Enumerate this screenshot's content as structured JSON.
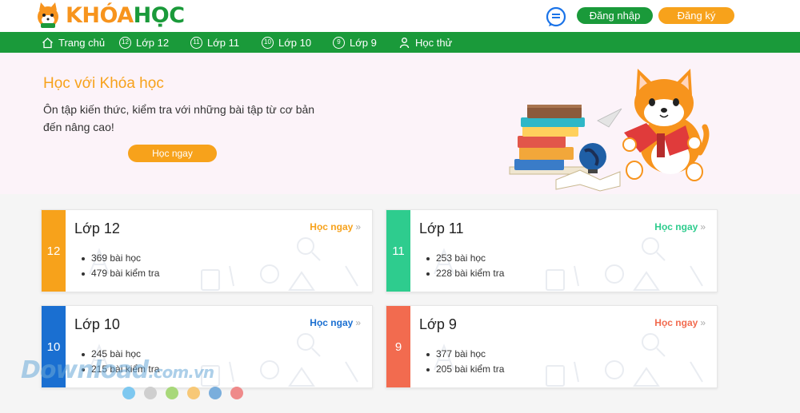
{
  "header": {
    "logo": {
      "part1": "KHÓA",
      "part2": "HỌC"
    },
    "login_label": "Đăng nhập",
    "register_label": "Đăng ký"
  },
  "nav": {
    "items": [
      {
        "label": "Trang chủ",
        "icon": "home-icon"
      },
      {
        "label": "Lớp 12",
        "icon": "12"
      },
      {
        "label": "Lớp 11",
        "icon": "11"
      },
      {
        "label": "Lớp 10",
        "icon": "10"
      },
      {
        "label": "Lớp 9",
        "icon": "9"
      },
      {
        "label": "Học thử",
        "icon": "user-icon"
      }
    ]
  },
  "hero": {
    "title": "Học với Khóa học",
    "description": "Ôn tập kiến thức, kiểm tra với những bài tập từ cơ bản đến nâng cao!",
    "button_label": "Học ngay"
  },
  "cards": [
    {
      "grade": "12",
      "title": "Lớp 12",
      "link": "Học ngay",
      "arrow": "»",
      "lessons": "369 bài học",
      "tests": "479 bài kiểm tra",
      "color": "#f7a21b"
    },
    {
      "grade": "11",
      "title": "Lớp 11",
      "link": "Học ngay",
      "arrow": "»",
      "lessons": "253 bài học",
      "tests": "228 bài kiểm tra",
      "color": "#2ecc8e"
    },
    {
      "grade": "10",
      "title": "Lớp 10",
      "link": "Học ngay",
      "arrow": "»",
      "lessons": "245 bài học",
      "tests": "215 bài kiểm tra",
      "color": "#1a6fd1"
    },
    {
      "grade": "9",
      "title": "Lớp 9",
      "link": "Học ngay",
      "arrow": "»",
      "lessons": "377 bài học",
      "tests": "205 bài kiểm tra",
      "color": "#f26b4f"
    }
  ],
  "watermark": {
    "main": "Download",
    "sub": ".com.vn"
  },
  "dot_colors": [
    "#7ec8f0",
    "#cfcfcf",
    "#a8d87a",
    "#f7c877",
    "#7aaedc",
    "#ef8a8a"
  ]
}
